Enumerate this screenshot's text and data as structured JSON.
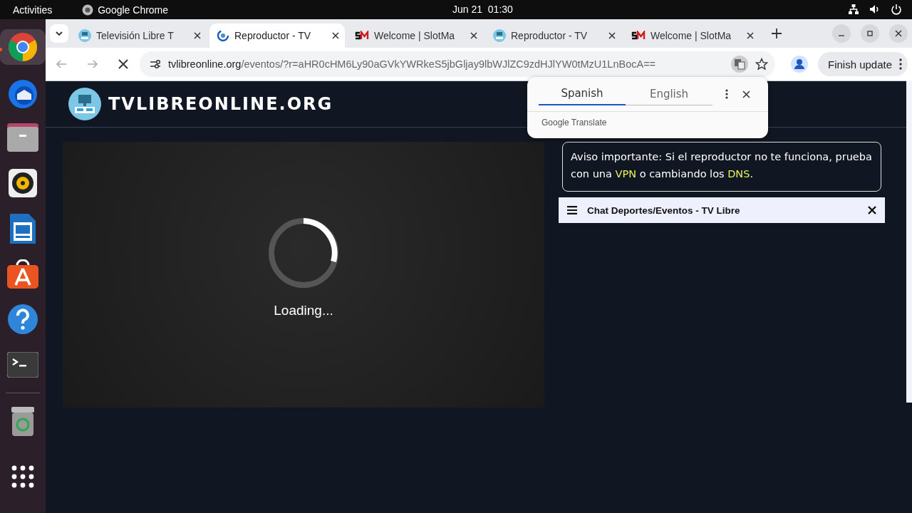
{
  "top_bar": {
    "activities": "Activities",
    "app_name": "Google Chrome",
    "clock": "Jun 21  01:30"
  },
  "dock": [
    {
      "kind": "chrome",
      "running": true
    },
    {
      "kind": "mail",
      "running": false
    },
    {
      "kind": "folder",
      "running": false
    },
    {
      "kind": "speaker",
      "running": false
    },
    {
      "kind": "document",
      "running": false
    },
    {
      "kind": "store",
      "running": false
    },
    {
      "kind": "help",
      "running": false
    },
    {
      "kind": "terminal",
      "running": false
    },
    {
      "kind": "trash",
      "running": false
    },
    {
      "kind": "apps",
      "running": false
    }
  ],
  "tabs": [
    {
      "title": "Televisión Libre T",
      "kind": "tv",
      "selected": false
    },
    {
      "title": "Reproductor - TV",
      "kind": "loading",
      "selected": true
    },
    {
      "title": "Welcome | SlotMa",
      "kind": "sm",
      "selected": false
    },
    {
      "title": "Reproductor - TV",
      "kind": "tv",
      "selected": false
    },
    {
      "title": "Welcome | SlotMa",
      "kind": "sm",
      "selected": false
    }
  ],
  "address_bar": {
    "host": "tvlibreonline.org",
    "path": "/eventos/?r=aHR0cHM6Ly90aGVkYWRkeS5jbGljay9lbWJlZC9zdHJlYW0tMzU1LnBocA==",
    "update_button": "Finish update"
  },
  "translate_popup": {
    "languages": [
      {
        "label": "Spanish",
        "selected": true
      },
      {
        "label": "English",
        "selected": false
      }
    ],
    "footer": "Google Translate"
  },
  "site": {
    "logo": "TVLIBREONLINE.ORG",
    "player": {
      "status": "Loading..."
    },
    "notice": "Aviso importante: Si el reproductor no te funciona, prueba con una **VPN** o cambiando los **DNS**.",
    "chat": {
      "title": "Chat Deportes/Eventos - TV Libre"
    }
  }
}
